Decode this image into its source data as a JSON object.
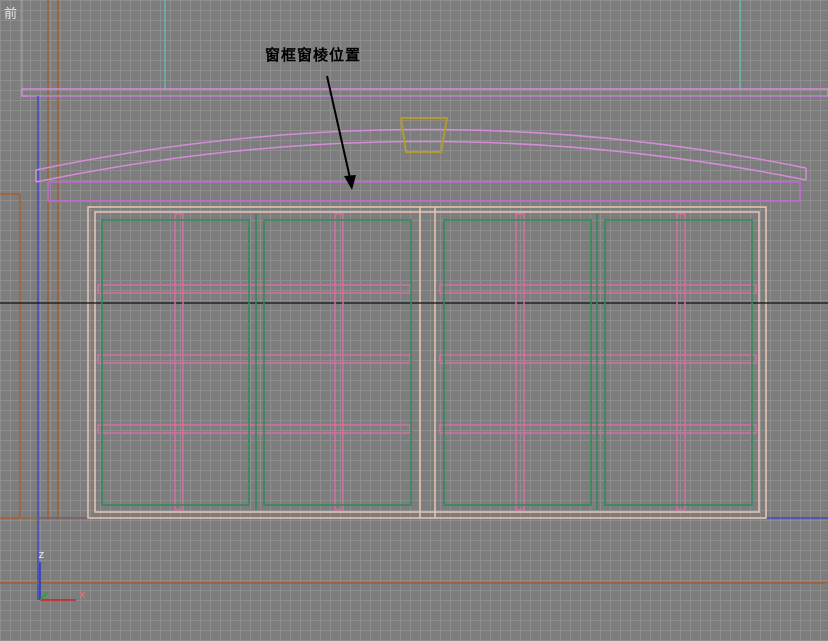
{
  "viewport": {
    "label": "前",
    "grid_visible": true
  },
  "annotation": {
    "text": "窗框窗棱位置"
  },
  "axis_gizmo": {
    "z_label": "z",
    "x_label": "x"
  },
  "colors": {
    "background": "#7d7d7d",
    "grid_line": "#8e8e8e",
    "frame_green": "#2e8a5c",
    "mullion_pink": "#d46fa0",
    "outer_frame_tan": "#e8c7b4",
    "arch_pink": "#d68cd9",
    "arch_magenta": "#c466d9",
    "wall_brown": "#a35f30",
    "blue_edge": "#3b4ac9",
    "cyan_edge": "#55d4c6",
    "keystone": "#b39a35",
    "horizon": "#111111",
    "axis_x": "#cc2222",
    "axis_y": "#22aa22",
    "axis_z": "#2233cc"
  }
}
